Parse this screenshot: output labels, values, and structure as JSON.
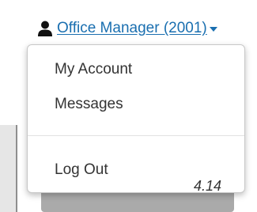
{
  "user_menu": {
    "label": "Office Manager (2001)",
    "icon": "user-icon",
    "caret_icon": "caret-down-icon"
  },
  "dropdown": {
    "items": [
      {
        "label": "My Account"
      },
      {
        "label": "Messages"
      },
      {
        "label": "Log Out"
      }
    ]
  },
  "version": "4.14",
  "colors": {
    "link": "#1a6fb0",
    "text": "#333333",
    "divider": "#e2e2e2"
  }
}
